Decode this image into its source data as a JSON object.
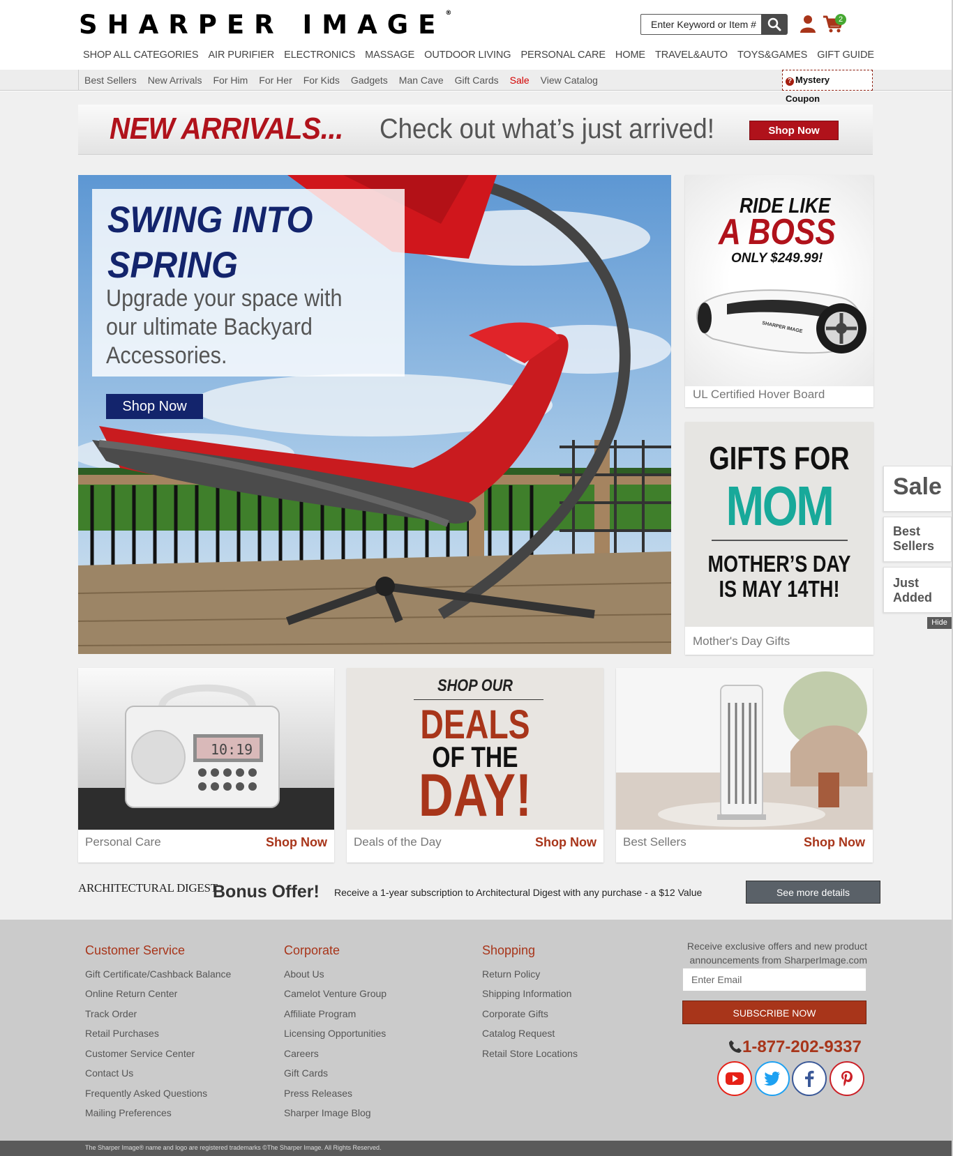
{
  "header": {
    "logo": "SHARPER IMAGE",
    "logo_mark": "®",
    "search_placeholder": "Enter Keyword or Item #",
    "cart_count": "2"
  },
  "main_nav": [
    "SHOP ALL CATEGORIES",
    "AIR PURIFIER",
    "ELECTRONICS",
    "MASSAGE",
    "OUTDOOR LIVING",
    "PERSONAL CARE",
    "HOME",
    "TRAVEL&AUTO",
    "TOYS&GAMES",
    "GIFT GUIDE"
  ],
  "sub_nav": [
    "Best Sellers",
    "New Arrivals",
    "For Him",
    "For Her",
    "For Kids",
    "Gadgets",
    "Man Cave",
    "Gift Cards",
    "Sale",
    "View Catalog"
  ],
  "mystery": {
    "line1": "Mystery",
    "line2": "Coupon",
    "icon": "?"
  },
  "banner": {
    "red_text": "NEW ARRIVALS...",
    "grey_text": "Check out what’s just arrived!",
    "button": "Shop Now"
  },
  "hero": {
    "title_line1": "SWING INTO",
    "title_line2": "SPRING",
    "subtitle": "Upgrade your space with our ultimate Backyard Accessories.",
    "button": "Shop Now"
  },
  "tile_boss": {
    "line1": "RIDE LIKE",
    "line2": "A BOSS",
    "price": "ONLY $249.99!",
    "caption": "UL Certified Hover Board"
  },
  "tile_mom": {
    "line1": "GIFTS FOR",
    "line2": "MOM",
    "date1": "MOTHER’S DAY",
    "date2": "IS MAY 14TH!",
    "caption": "Mother's Day Gifts"
  },
  "bottom_tiles": [
    {
      "caption": "Personal Care",
      "link": "Shop Now",
      "clock": "10:19"
    },
    {
      "caption": "Deals of the Day",
      "link": "Shop Now",
      "shop_our": "SHOP OUR",
      "deals": "DEALS",
      "of_the": "OF THE",
      "day": "DAY!"
    },
    {
      "caption": "Best Sellers",
      "link": "Shop Now"
    }
  ],
  "side_tabs": {
    "sale": "Sale",
    "best_line1": "Best",
    "best_line2": "Sellers",
    "just_line1": "Just",
    "just_line2": "Added",
    "hide": "Hide"
  },
  "bonus": {
    "brand": "ARCHITECTURAL DIGEST",
    "title": "Bonus Offer!",
    "text": "Receive a 1-year subscription to Architectural Digest with any purchase - a $12 Value",
    "button": "See more details"
  },
  "footer": {
    "customer_service": {
      "title": "Customer Service",
      "links": [
        "Gift Certificate/Cashback Balance",
        "Online Return Center",
        "Track Order",
        "Retail Purchases",
        "Customer Service Center",
        "Contact Us",
        "Frequently Asked Questions",
        "Mailing Preferences"
      ]
    },
    "corporate": {
      "title": "Corporate",
      "links": [
        "About Us",
        "Camelot Venture Group",
        "Affiliate Program",
        "Licensing Opportunities",
        "Careers",
        "Gift Cards",
        "Press Releases",
        "Sharper Image Blog"
      ]
    },
    "shopping": {
      "title": "Shopping",
      "links": [
        "Return Policy",
        "Shipping Information",
        "Corporate Gifts",
        "Catalog Request",
        "Retail Store Locations"
      ]
    },
    "signup_text": "Receive exclusive offers and new product announcements from SharperImage.com",
    "email_placeholder": "Enter Email",
    "subscribe": "SUBSCRIBE NOW",
    "phone": "1-877-202-9337",
    "copyright": "The Sharper Image® name and logo are registered trademarks ©The Sharper Image. All Rights Reserved."
  },
  "colors": {
    "brand_red": "#b0121b",
    "rust": "#a8351a",
    "navy": "#13246c",
    "teal": "#18a99a",
    "youtube": "#e62117",
    "twitter": "#1da1f2",
    "facebook": "#3b5998",
    "pinterest": "#cb2027"
  }
}
